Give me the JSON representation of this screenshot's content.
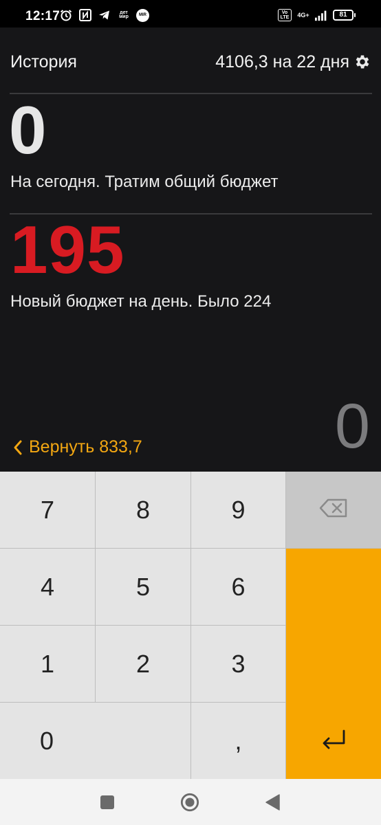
{
  "status_bar": {
    "time": "12:17",
    "icons_left": [
      "alarm-icon",
      "nfc-icon",
      "telegram-icon",
      "detmir-icon",
      "mir-icon"
    ],
    "detmir_text": "дет мир",
    "mir_text": "MIR",
    "volte": "Vo LTE",
    "network": "4G+",
    "battery": "81"
  },
  "header": {
    "history_label": "История",
    "budget_info": "4106,3 на 22 дня",
    "settings_icon": "gear-icon"
  },
  "today": {
    "amount": "0",
    "label": "На сегодня. Тратим общий бюджет"
  },
  "new_budget": {
    "amount": "195",
    "label": "Новый бюджет на день. Было 224",
    "amount_color": "#d81b22"
  },
  "input": {
    "value": "0"
  },
  "return_link": {
    "label": "Вернуть 833,7",
    "color": "#f3a712"
  },
  "keypad": {
    "keys": [
      "7",
      "8",
      "9",
      "4",
      "5",
      "6",
      "1",
      "2",
      "3",
      "0",
      ","
    ],
    "backspace_icon": "backspace-icon",
    "enter_icon": "enter-icon",
    "enter_color": "#f7a600"
  },
  "nav_bar": {
    "recents_icon": "square-icon",
    "home_icon": "circle-icon",
    "back_icon": "triangle-back-icon"
  }
}
